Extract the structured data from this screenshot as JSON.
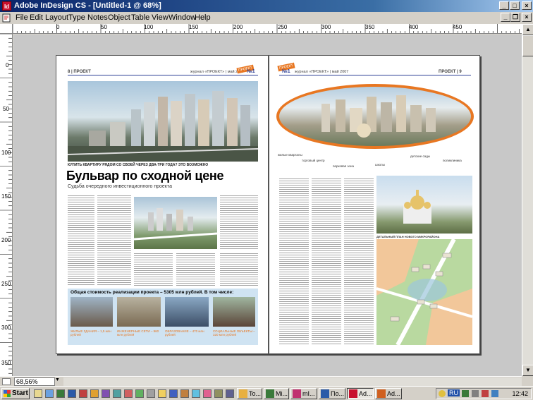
{
  "window": {
    "title": "Adobe InDesign CS - [Untitled-1 @ 68%]",
    "controls": {
      "minimize": "_",
      "maximize": "□",
      "close": "×"
    }
  },
  "menu": [
    "File",
    "Edit",
    "Layout",
    "Type",
    "Notes",
    "Object",
    "Table",
    "View",
    "Window",
    "Help"
  ],
  "ruler": {
    "top_labels": [
      "0",
      "50",
      "100",
      "150",
      "200",
      "250",
      "300",
      "350",
      "400",
      "450"
    ],
    "left_labels": [
      "0",
      "50",
      "100",
      "150",
      "200",
      "250",
      "300",
      "350"
    ]
  },
  "zoom": "68,56%",
  "left_page": {
    "folio": "8 | ПРОЕКТ",
    "header_mid": "журнал «ПРОЕКТ» | май 2007",
    "issue": "№1",
    "strap": "КУПИТЬ КВАРТИРУ РЯДОМ СО СВОЕЙ ЧЕРЕЗ ДВА-ТРИ ГОДА? ЭТО ВОЗМОЖНО",
    "headline": "Бульвар по сходной цене",
    "subhead": "Судьба очередного инвестиционного проекта",
    "bottom_title": "Общая стоимость реализации проекта – 5305 млн рублей. В том числе:",
    "bottom_captions": [
      "ЖИЛЫЕ ЗДАНИЯ – 1,5 млн рублей",
      "ИНЖЕНЕРНЫЕ СЕТИ – 960 млн рублей",
      "ОБРАЗОВАНИЕ – 470 млн рублей",
      "СОЦИАЛЬНЫЕ ОБЪЕКТЫ – 320 млн рублей"
    ]
  },
  "right_page": {
    "issue": "№1",
    "header_mid": "журнал «ПРОЕКТ» | май 2007",
    "folio": "ПРОЕКТ | 9",
    "labels": [
      "жилые кварталы",
      "торговый центр",
      "парковая зона",
      "школы",
      "детские сады",
      "поликлиника"
    ],
    "caption": "ДЕТАЛЬНЫЙ ПЛАН НОВОГО МИКРОРАЙОНА"
  },
  "taskbar": {
    "start": "Start",
    "items": [
      "To...",
      "Mi...",
      "mI...",
      "По...",
      "Ad...",
      "Ad..."
    ],
    "lang": "RU",
    "clock": "12:42"
  },
  "colors": {
    "accent_orange": "#e87722",
    "issue_blue": "#2c3e95",
    "title_bar": "#0a246a"
  }
}
